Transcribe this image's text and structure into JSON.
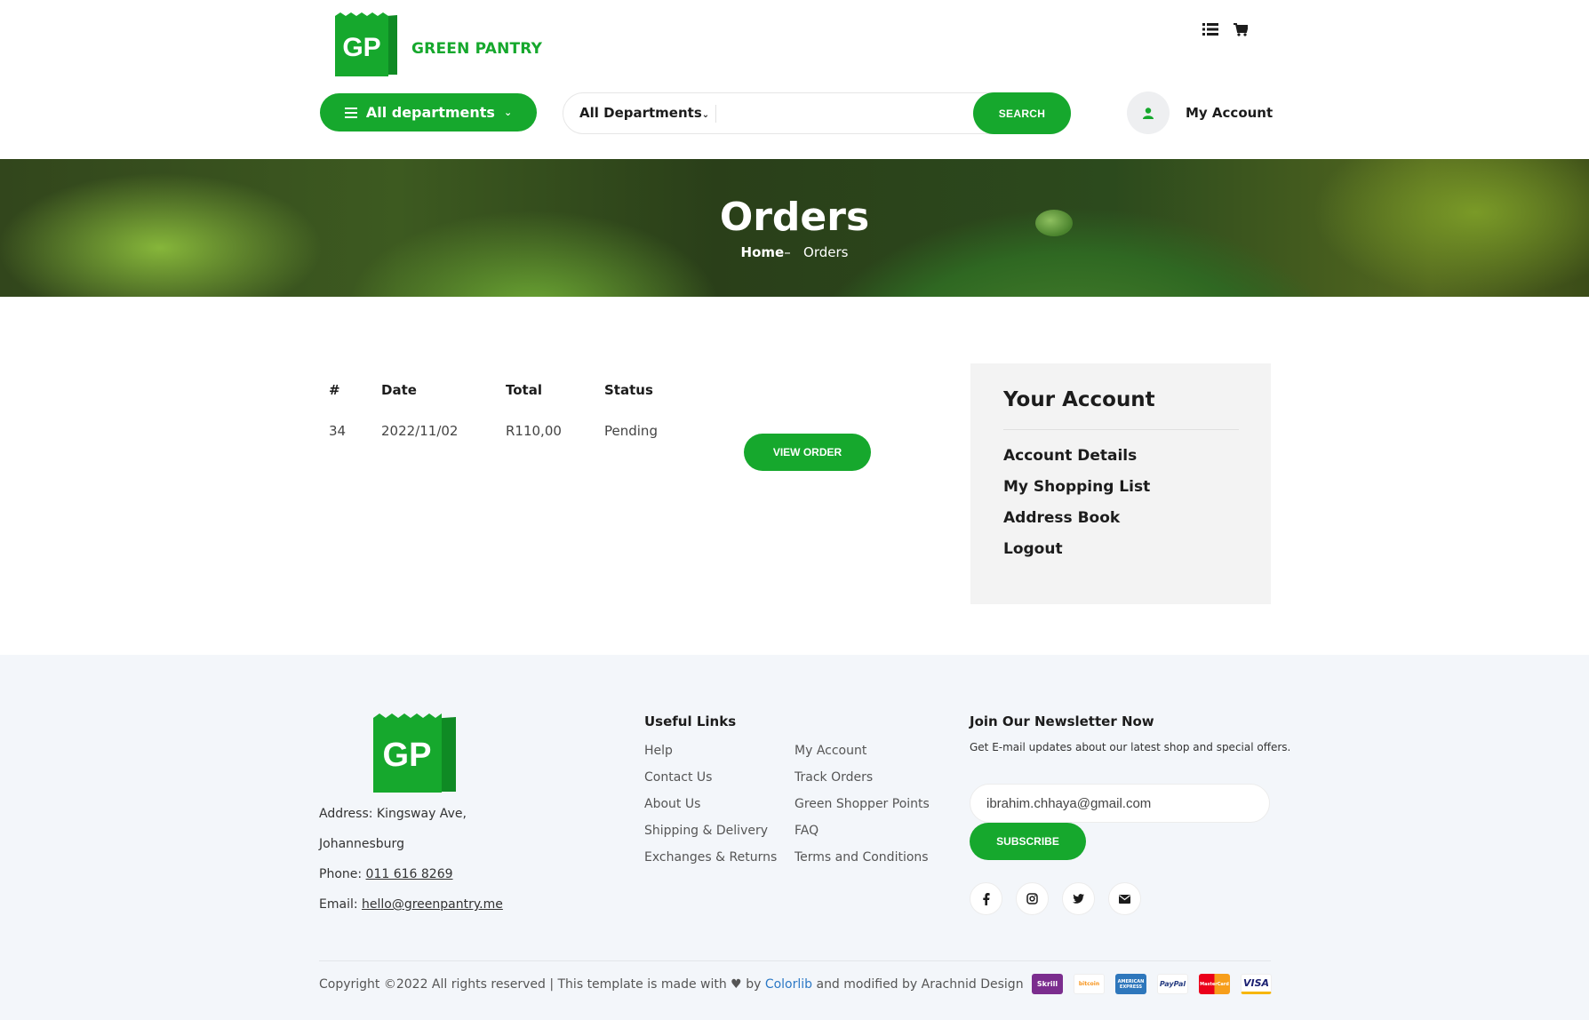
{
  "brand": {
    "logo_initials": "GP",
    "name": "GREEN PANTRY",
    "accent_color": "#16a82d"
  },
  "header": {
    "top_icons": [
      "list-icon",
      "cart-icon"
    ],
    "departments_button": "All departments",
    "search": {
      "category": "All Departments",
      "placeholder": "",
      "button": "SEARCH"
    },
    "account_label": "My Account"
  },
  "hero": {
    "title": "Orders",
    "breadcrumb_home": "Home",
    "breadcrumb_sep": "–",
    "breadcrumb_current": "Orders"
  },
  "orders": {
    "columns": [
      "#",
      "Date",
      "Total",
      "Status"
    ],
    "rows": [
      {
        "num": "34",
        "date": "2022/11/02",
        "total": "R110,00",
        "status": "Pending",
        "action": "VIEW ORDER"
      }
    ]
  },
  "sidebar": {
    "title": "Your Account",
    "items": [
      "Account Details",
      "My Shopping List",
      "Address Book",
      "Logout"
    ]
  },
  "footer": {
    "address_line1": "Address: Kingsway Ave,",
    "address_line2": "Johannesburg",
    "phone_label": "Phone: ",
    "phone": "011 616 8269",
    "email_label": "Email: ",
    "email": "hello@greenpantry.me",
    "links_title": "Useful Links",
    "links_col1": [
      "Help",
      "Contact Us",
      "About Us",
      "Shipping & Delivery",
      "Exchanges & Returns"
    ],
    "links_col2": [
      "My Account",
      "Track Orders",
      "Green Shopper Points",
      "FAQ",
      "Terms and Conditions"
    ],
    "newsletter_title": "Join Our Newsletter Now",
    "newsletter_text": "Get E-mail updates about our latest shop and special offers.",
    "newsletter_value": "ibrahim.chhaya@gmail.com",
    "subscribe": "SUBSCRIBE",
    "social_icons": [
      "facebook-icon",
      "instagram-icon",
      "twitter-icon",
      "email-icon"
    ],
    "copyright_pre": "Copyright ©2022 All rights reserved | This template is made with",
    "copyright_by": "by",
    "copyright_link": "Colorlib",
    "copyright_post": "and modified by Arachnid Design",
    "payments": [
      "Skrill",
      "bitcoin",
      "AMERICAN EXPRESS",
      "PayPal",
      "MasterCard",
      "VISA"
    ]
  }
}
